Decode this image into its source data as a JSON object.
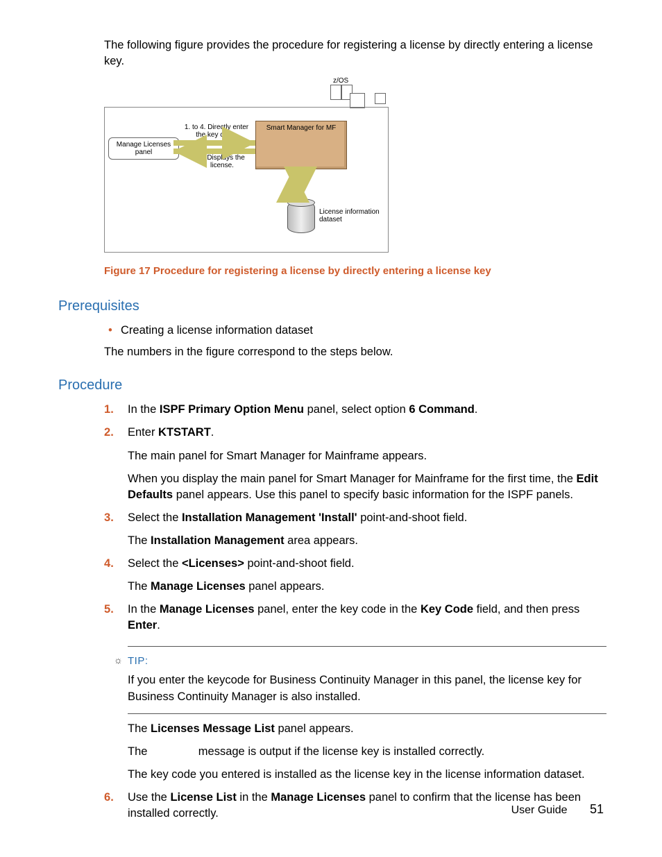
{
  "intro": "The following figure provides the procedure for registering a license by directly entering a license key.",
  "figure": {
    "caption": "Figure 17 Procedure for registering a license by directly entering a license key",
    "zos_label": "z/OS",
    "manage_panel": "Manage Licenses panel",
    "step_enter": "1. to 4. Directly enter the key code.",
    "smart_mgr": "Smart Manager for MF",
    "step_display": "5. Displays the license.",
    "dataset": "License information dataset"
  },
  "prereq_heading": "Prerequisites",
  "prereq_items": [
    "Creating a license information dataset"
  ],
  "prereq_after": "The numbers in the figure correspond to the steps below.",
  "proc_heading": "Procedure",
  "steps": {
    "s1": {
      "a": "In the ",
      "b1": "ISPF Primary Option Menu",
      "c": " panel, select option ",
      "b2": "6 Command",
      "d": "."
    },
    "s2": {
      "a": "Enter ",
      "b1": "KTSTART",
      "c": ".",
      "p1": "The main panel for Smart Manager for Mainframe appears.",
      "p2a": "When you display the main panel for Smart Manager for Mainframe for the first time, the ",
      "p2b": "Edit Defaults",
      "p2c": " panel appears. Use this panel to specify basic information for the ISPF panels."
    },
    "s3": {
      "a": "Select the ",
      "b1": "Installation Management 'Install'",
      "c": " point-and-shoot field.",
      "p1a": "The ",
      "p1b": "Installation Management",
      "p1c": " area appears."
    },
    "s4": {
      "a": "Select the ",
      "b1": "<Licenses>",
      "c": " point-and-shoot field.",
      "p1a": "The ",
      "p1b": "Manage Licenses",
      "p1c": " panel appears."
    },
    "s5": {
      "a": "In the ",
      "b1": "Manage Licenses",
      "c": " panel, enter the key code in the ",
      "b2": "Key Code",
      "d": " field, and then press ",
      "b3": "Enter",
      "e": ".",
      "tip_label": "TIP:",
      "tip_body": "If you enter the keycode for Business Continuity Manager in this panel, the license key for Business Continuity Manager is also installed.",
      "p1a": "The ",
      "p1b": "Licenses Message List",
      "p1c": " panel appears.",
      "p2": "The                message is output if the license key is installed correctly.",
      "p3": "The key code you entered is installed as the license key in the license information dataset."
    },
    "s6": {
      "a": "Use the ",
      "b1": "License List",
      "c": " in the ",
      "b2": "Manage Licenses",
      "d": " panel to confirm that the license has been installed correctly."
    }
  },
  "footer": {
    "label": "User Guide",
    "page": "51"
  }
}
